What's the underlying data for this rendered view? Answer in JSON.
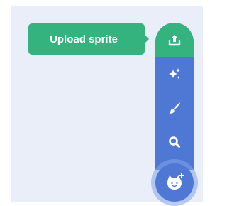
{
  "tooltip": {
    "label": "Upload sprite"
  },
  "sprite_menu": {
    "items": [
      {
        "name": "upload-sprite",
        "icon": "upload-icon",
        "state": "hovered",
        "color": "#35b37e"
      },
      {
        "name": "surprise",
        "icon": "sparkle-icon"
      },
      {
        "name": "paint",
        "icon": "paintbrush-icon"
      },
      {
        "name": "choose-sprite",
        "icon": "search-icon"
      }
    ],
    "main_button_icon": "cat-plus-icon",
    "accent_color": "#4f78d4"
  }
}
